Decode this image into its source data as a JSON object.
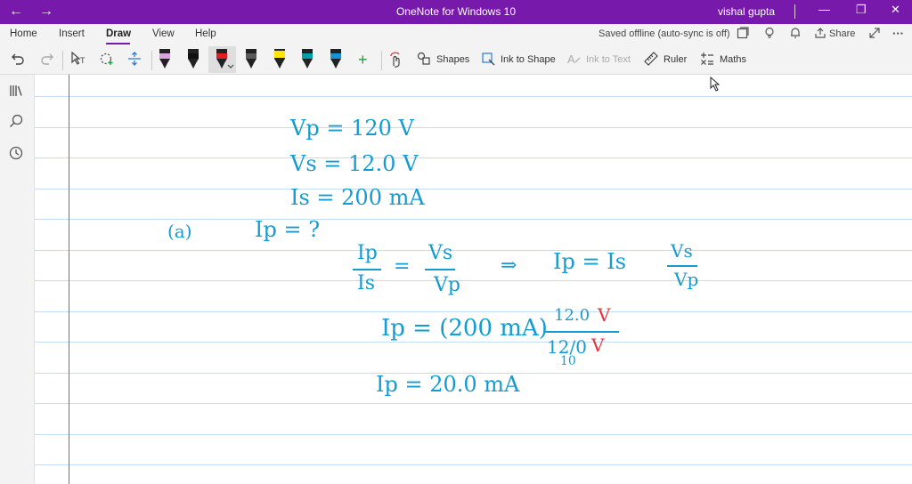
{
  "titlebar": {
    "back_glyph": "←",
    "forward_glyph": "→",
    "title": "OneNote for Windows 10",
    "user": "vishal gupta",
    "minimize_glyph": "—",
    "restore_glyph": "❐",
    "close_glyph": "✕",
    "color": "#7719aa"
  },
  "menu": {
    "items": [
      "Home",
      "Insert",
      "Draw",
      "View",
      "Help"
    ],
    "active": "Draw",
    "status": "Saved offline (auto-sync is off)",
    "share_label": "Share",
    "more_glyph": "···"
  },
  "ribbon": {
    "shapes_label": "Shapes",
    "ink_to_shape_label": "Ink to Shape",
    "ink_to_text_label": "Ink to Text",
    "ruler_label": "Ruler",
    "maths_label": "Maths",
    "add_pen_glyph": "+",
    "pens": [
      {
        "name": "pen-pink-pencil",
        "color": "#d8a4de"
      },
      {
        "name": "pen-black",
        "color": "#111111"
      },
      {
        "name": "pen-red",
        "color": "#e01e24"
      },
      {
        "name": "pen-gray",
        "color": "#5a5a5a"
      },
      {
        "name": "highlighter-yellow",
        "color": "#ffe600"
      },
      {
        "name": "pen-teal",
        "color": "#00a0a8"
      },
      {
        "name": "pen-blue",
        "color": "#1c8fd6"
      }
    ]
  },
  "notes": {
    "line1": "Vp = 120 V",
    "line2": "Vs =  12.0 V",
    "line3": "Is =  200 mA",
    "part_label": "(a)",
    "line4": "Ip = ?",
    "ratio_lhs_top": "Ip",
    "ratio_lhs_bottom": "Is",
    "ratio_eq": "=",
    "ratio_rhs_top": "Vs",
    "ratio_rhs_bottom": "Vp",
    "implies": "⇒",
    "ratio_solved": "Ip = Is",
    "ratio_solved_top": "Vs",
    "ratio_solved_bottom": "Vp",
    "sub_lhs": "Ip = (200 mA)",
    "sub_num": "12.0",
    "sub_den": "12/0",
    "sub_den_small": "10",
    "cancel_v": "V",
    "result": "Ip = 20.0 mA",
    "ink_color": "#169bd1",
    "cancel_color": "#e5333d"
  }
}
